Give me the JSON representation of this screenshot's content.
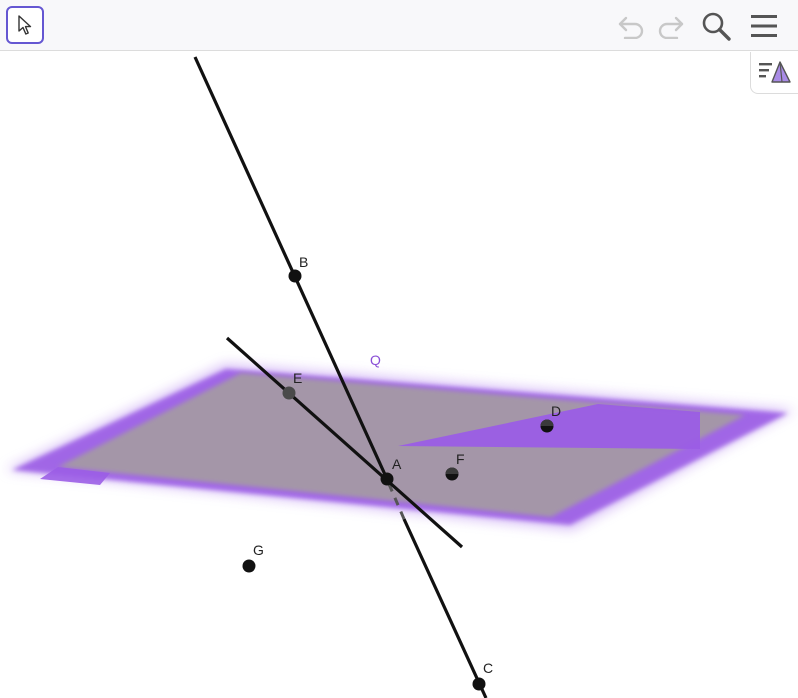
{
  "toolbar": {
    "icons": [
      "move-cursor-icon",
      "undo-icon",
      "redo-icon",
      "search-icon",
      "hamburger-menu-icon"
    ]
  },
  "view_tab": {
    "icon": "3d-graphics-view-icon"
  },
  "colors": {
    "plane": "#9b5de5",
    "plane_inner": "#a496a8",
    "line": "#111111",
    "point": "#111111",
    "plane_label": "#8a4fd6",
    "tool_border": "#6557d2"
  },
  "scene": {
    "plane_label": "Q",
    "points": {
      "A": "A",
      "B": "B",
      "C": "C",
      "D": "D",
      "E": "E",
      "F": "F",
      "G": "G"
    }
  }
}
